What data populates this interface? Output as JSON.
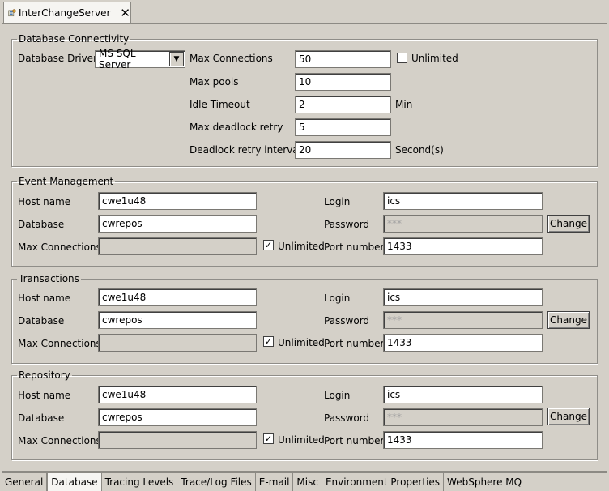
{
  "editor_tab": {
    "title": "InterChangeServer",
    "close_glyph": "✕"
  },
  "database_connectivity": {
    "legend": "Database Connectivity",
    "driver_label": "Database Driver",
    "driver_value": "MS SQL Server",
    "max_connections_label": "Max Connections",
    "max_connections_value": "50",
    "unlimited_label": "Unlimited",
    "unlimited_checked": false,
    "max_pools_label": "Max pools",
    "max_pools_value": "10",
    "idle_timeout_label": "Idle Timeout",
    "idle_timeout_value": "2",
    "idle_timeout_unit": "Min",
    "max_deadlock_label": "Max deadlock retry",
    "max_deadlock_value": "5",
    "deadlock_interval_label": "Deadlock retry interval",
    "deadlock_interval_value": "20",
    "deadlock_interval_unit": "Second(s)"
  },
  "event_management": {
    "legend": "Event Management",
    "host_label": "Host name",
    "host_value": "cwe1u48",
    "database_label": "Database",
    "database_value": "cwrepos",
    "max_conn_label": "Max Connections",
    "max_conn_value": "",
    "unlimited_label": "Unlimited",
    "unlimited_mark": "✓",
    "login_label": "Login",
    "login_value": "ics",
    "password_label": "Password",
    "password_value": "***",
    "change_label": "Change",
    "port_label": "Port number",
    "port_value": "1433"
  },
  "transactions": {
    "legend": "Transactions",
    "host_label": "Host name",
    "host_value": "cwe1u48",
    "database_label": "Database",
    "database_value": "cwrepos",
    "max_conn_label": "Max Connections",
    "max_conn_value": "",
    "unlimited_label": "Unlimited",
    "unlimited_mark": "✓",
    "login_label": "Login",
    "login_value": "ics",
    "password_label": "Password",
    "password_value": "***",
    "change_label": "Change",
    "port_label": "Port number",
    "port_value": "1433"
  },
  "repository": {
    "legend": "Repository",
    "host_label": "Host name",
    "host_value": "cwe1u48",
    "database_label": "Database",
    "database_value": "cwrepos",
    "max_conn_label": "Max Connections",
    "max_conn_value": "",
    "unlimited_label": "Unlimited",
    "unlimited_mark": "✓",
    "login_label": "Login",
    "login_value": "ics",
    "password_label": "Password",
    "password_value": "***",
    "change_label": "Change",
    "port_label": "Port number",
    "port_value": "1433"
  },
  "bottom_tabs": {
    "general": "General",
    "database": "Database",
    "tracing": "Tracing Levels",
    "trace_log": "Trace/Log Files",
    "email": "E-mail",
    "misc": "Misc",
    "environment": "Environment Properties",
    "websphere": "WebSphere MQ"
  }
}
